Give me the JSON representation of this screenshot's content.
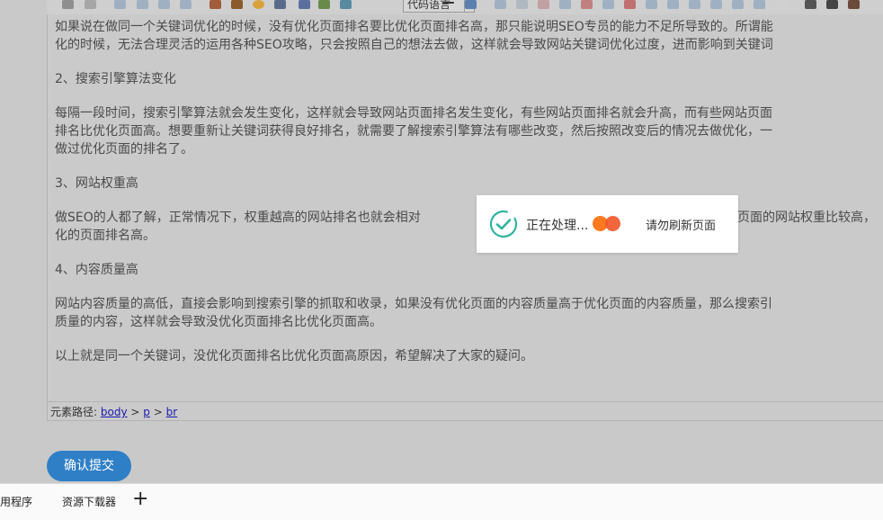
{
  "toolbar": {
    "code_language_label": "代码语言"
  },
  "editor": {
    "paragraphs": [
      "如果说在做同一个关键词优化的时候，没有优化页面排名要比优化页面排名高，那只能说明SEO专员的能力不足所导致的。所谓能",
      "化的时候，无法合理灵活的运用各种SEO攻略，只会按照自己的想法去做，这样就会导致网站关键词优化过度，进而影响到关键词",
      "2、搜索引擎算法变化",
      "每隔一段时间，搜索引擎算法就会发生变化，这样就会导致网站页面排名发生变化，有些网站页面排名就会升高，而有些网站页面",
      "排名比优化页面高。想要重新让关键词获得良好排名，就需要了解搜索引擎算法有哪些改变，然后按照改变后的情况去做优化，一",
      "做过优化页面的排名了。",
      "3、网站权重高",
      "做SEO的人都了解，正常情况下，权重越高的网站排名也就会相对",
      "化的页面排名高。",
      "4、内容质量高",
      "网站内容质量的高低，直接会影响到搜索引擎的抓取和收录，如果没有优化页面的内容质量高于优化页面的内容质量，那么搜索引",
      "质量的内容，这样就会导致没优化页面排名比优化页面高。",
      "以上就是同一个关键词，没优化页面排名比优化页面高原因，希望解决了大家的疑问。"
    ],
    "partial_right_text": "页面的网站权重比较高，"
  },
  "pathbar": {
    "label": "元素路径:",
    "crumbs": [
      "body",
      "p",
      "br"
    ],
    "separator": ">"
  },
  "submit_button": {
    "label": "确认提交"
  },
  "bottom_bar": {
    "items": [
      "用程序",
      "资源下载器"
    ],
    "add_label": "+"
  },
  "dialog": {
    "processing_text": "正在处理...",
    "hint_text": "请勿刷新页面",
    "icon": "check-circle-icon",
    "accent_color": "#2fb3a0"
  },
  "colors": {
    "overlay": "#c9c9c9",
    "button": "#2f7fc6",
    "dot_orange": "#ff7a1f",
    "dot_red": "#ef5528"
  }
}
